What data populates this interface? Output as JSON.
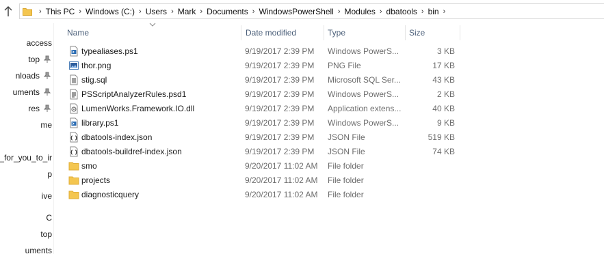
{
  "address": {
    "breadcrumbs": [
      "This PC",
      "Windows (C:)",
      "Users",
      "Mark",
      "Documents",
      "WindowsPowerShell",
      "Modules",
      "dbatools",
      "bin"
    ]
  },
  "nav": {
    "items": [
      {
        "label": "access",
        "pinned": false
      },
      {
        "label": "top",
        "pinned": true
      },
      {
        "label": "nloads",
        "pinned": true
      },
      {
        "label": "uments",
        "pinned": true
      },
      {
        "label": "res",
        "pinned": true
      },
      {
        "label": "me",
        "pinned": false
      },
      {
        "label": "s_for_you_to_ir",
        "pinned": false
      },
      {
        "label": "p",
        "pinned": false
      },
      {
        "label": "ive",
        "pinned": false
      },
      {
        "label": "C",
        "pinned": false
      },
      {
        "label": "top",
        "pinned": false
      },
      {
        "label": "uments",
        "pinned": false
      }
    ]
  },
  "columns": {
    "name": "Name",
    "date": "Date modified",
    "type": "Type",
    "size": "Size"
  },
  "files": [
    {
      "name": "typealiases.ps1",
      "date": "9/19/2017 2:39 PM",
      "type": "Windows PowerS...",
      "size": "3 KB",
      "icon": "powershell-script-icon"
    },
    {
      "name": "thor.png",
      "date": "9/19/2017 2:39 PM",
      "type": "PNG File",
      "size": "17 KB",
      "icon": "image-file-icon"
    },
    {
      "name": "stig.sql",
      "date": "9/19/2017 2:39 PM",
      "type": "Microsoft SQL Ser...",
      "size": "43 KB",
      "icon": "sql-file-icon"
    },
    {
      "name": "PSScriptAnalyzerRules.psd1",
      "date": "9/19/2017 2:39 PM",
      "type": "Windows PowerS...",
      "size": "2 KB",
      "icon": "powershell-data-icon"
    },
    {
      "name": "LumenWorks.Framework.IO.dll",
      "date": "9/19/2017 2:39 PM",
      "type": "Application extens...",
      "size": "40 KB",
      "icon": "dll-file-icon"
    },
    {
      "name": "library.ps1",
      "date": "9/19/2017 2:39 PM",
      "type": "Windows PowerS...",
      "size": "9 KB",
      "icon": "powershell-script-icon"
    },
    {
      "name": "dbatools-index.json",
      "date": "9/19/2017 2:39 PM",
      "type": "JSON File",
      "size": "519 KB",
      "icon": "json-file-icon"
    },
    {
      "name": "dbatools-buildref-index.json",
      "date": "9/19/2017 2:39 PM",
      "type": "JSON File",
      "size": "74 KB",
      "icon": "json-file-icon"
    },
    {
      "name": "smo",
      "date": "9/20/2017 11:02 AM",
      "type": "File folder",
      "size": "",
      "icon": "folder-icon"
    },
    {
      "name": "projects",
      "date": "9/20/2017 11:02 AM",
      "type": "File folder",
      "size": "",
      "icon": "folder-icon"
    },
    {
      "name": "diagnosticquery",
      "date": "9/20/2017 11:02 AM",
      "type": "File folder",
      "size": "",
      "icon": "folder-icon"
    }
  ],
  "colors": {
    "header_text": "#4c607a",
    "folder_yellow": "#f4c650",
    "detail_text": "#6d6d6d"
  }
}
